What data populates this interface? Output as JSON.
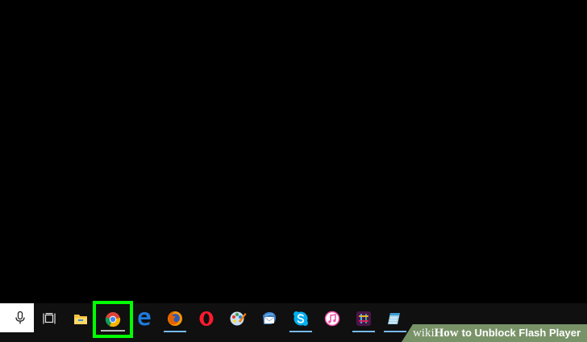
{
  "desktop": {
    "background": "#000000"
  },
  "taskbar": {
    "background": "#101010",
    "accent": "#76b9ed",
    "highlight_color": "#00ff00",
    "search_icon": "microphone-icon",
    "buttons": [
      {
        "name": "task-view",
        "icon": "task-view-icon"
      },
      {
        "name": "file-explorer",
        "icon": "folder-icon"
      },
      {
        "name": "google-chrome",
        "icon": "chrome-icon",
        "highlighted": true
      },
      {
        "name": "microsoft-edge",
        "icon": "edge-icon"
      },
      {
        "name": "firefox",
        "icon": "firefox-icon"
      },
      {
        "name": "opera",
        "icon": "opera-icon"
      },
      {
        "name": "paint-dot-net",
        "icon": "paint-icon"
      },
      {
        "name": "thunderbird",
        "icon": "thunderbird-icon"
      },
      {
        "name": "skype",
        "icon": "skype-icon"
      },
      {
        "name": "itunes",
        "icon": "itunes-icon"
      },
      {
        "name": "slack",
        "icon": "slack-icon"
      },
      {
        "name": "notepad",
        "icon": "notepad-icon"
      }
    ]
  },
  "watermark": {
    "wiki": "wiki",
    "how": "How",
    "title": "to Unblock Flash Player"
  }
}
